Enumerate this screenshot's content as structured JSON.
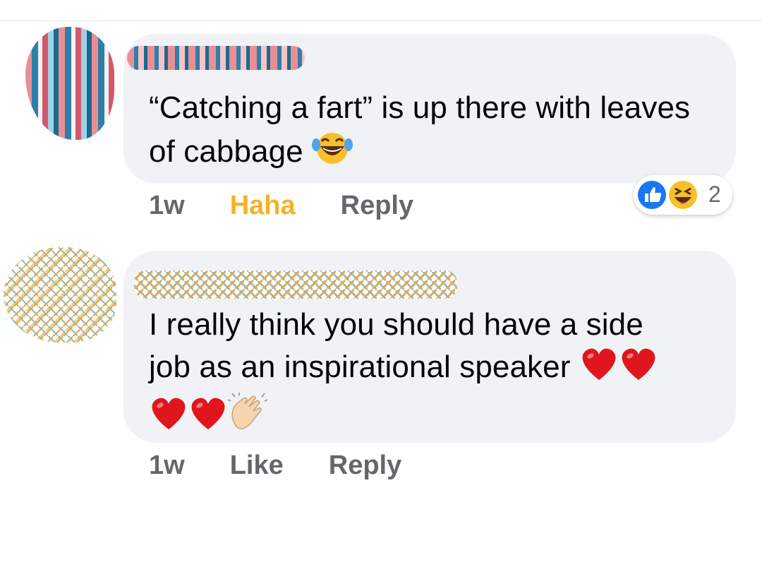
{
  "comments": [
    {
      "text": "“Catching a fart” is up there with leaves of cabbage",
      "time": "1w",
      "reaction_label": "Haha",
      "reply_label": "Reply",
      "reaction_count": "2",
      "reaction_icons": [
        "like-icon",
        "haha-icon"
      ],
      "inline_emoji": [
        "laughing-tears-emoji"
      ]
    },
    {
      "text_line1": "I really think you should have a side",
      "text_line2": "job as an inspirational speaker",
      "time": "1w",
      "reaction_label": "Like",
      "reply_label": "Reply",
      "inline_emoji": [
        "red-heart-emoji",
        "red-heart-emoji",
        "red-heart-emoji",
        "red-heart-emoji",
        "clapping-hands-emoji"
      ]
    }
  ],
  "colors": {
    "bubble": "#f0f2f5",
    "action_gray": "#65676b",
    "haha_yellow": "#f7b125",
    "like_blue": "#1877f2",
    "heart_red": "#e0161f"
  }
}
